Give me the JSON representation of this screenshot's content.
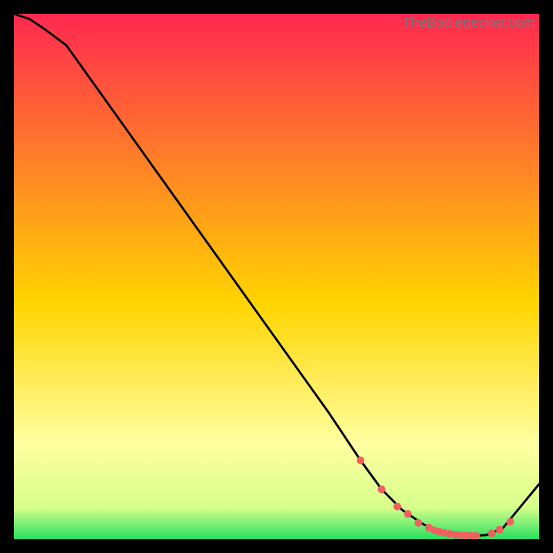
{
  "watermark": "TheBottlenecker.com",
  "colors": {
    "top": "#ff2850",
    "mid": "#ffd400",
    "pale": "#ffffa0",
    "green": "#28e060",
    "line": "#000000",
    "marker": "#f06060",
    "bg": "#000000"
  },
  "chart_data": {
    "type": "line",
    "title": "",
    "xlabel": "",
    "ylabel": "",
    "xlim": [
      0,
      100
    ],
    "ylim": [
      0,
      100
    ],
    "x": [
      0,
      3,
      6,
      10,
      20,
      30,
      40,
      50,
      60,
      66,
      70,
      74,
      78,
      82,
      85,
      88,
      90,
      93,
      100
    ],
    "y": [
      100,
      99,
      97,
      94,
      80,
      66,
      52,
      38,
      24,
      15,
      9.5,
      5.5,
      2.8,
      1.2,
      0.7,
      0.6,
      0.8,
      2.0,
      10.5
    ],
    "markers": {
      "x": [
        66,
        70,
        73,
        75,
        77,
        79,
        80,
        81,
        82,
        83,
        84,
        85,
        86,
        87,
        88,
        91,
        92.5,
        94.5
      ],
      "y": [
        15,
        9.5,
        6.2,
        4.8,
        3.1,
        2.2,
        1.7,
        1.4,
        1.2,
        1.0,
        0.85,
        0.75,
        0.7,
        0.68,
        0.64,
        1.1,
        1.8,
        3.3
      ]
    }
  }
}
